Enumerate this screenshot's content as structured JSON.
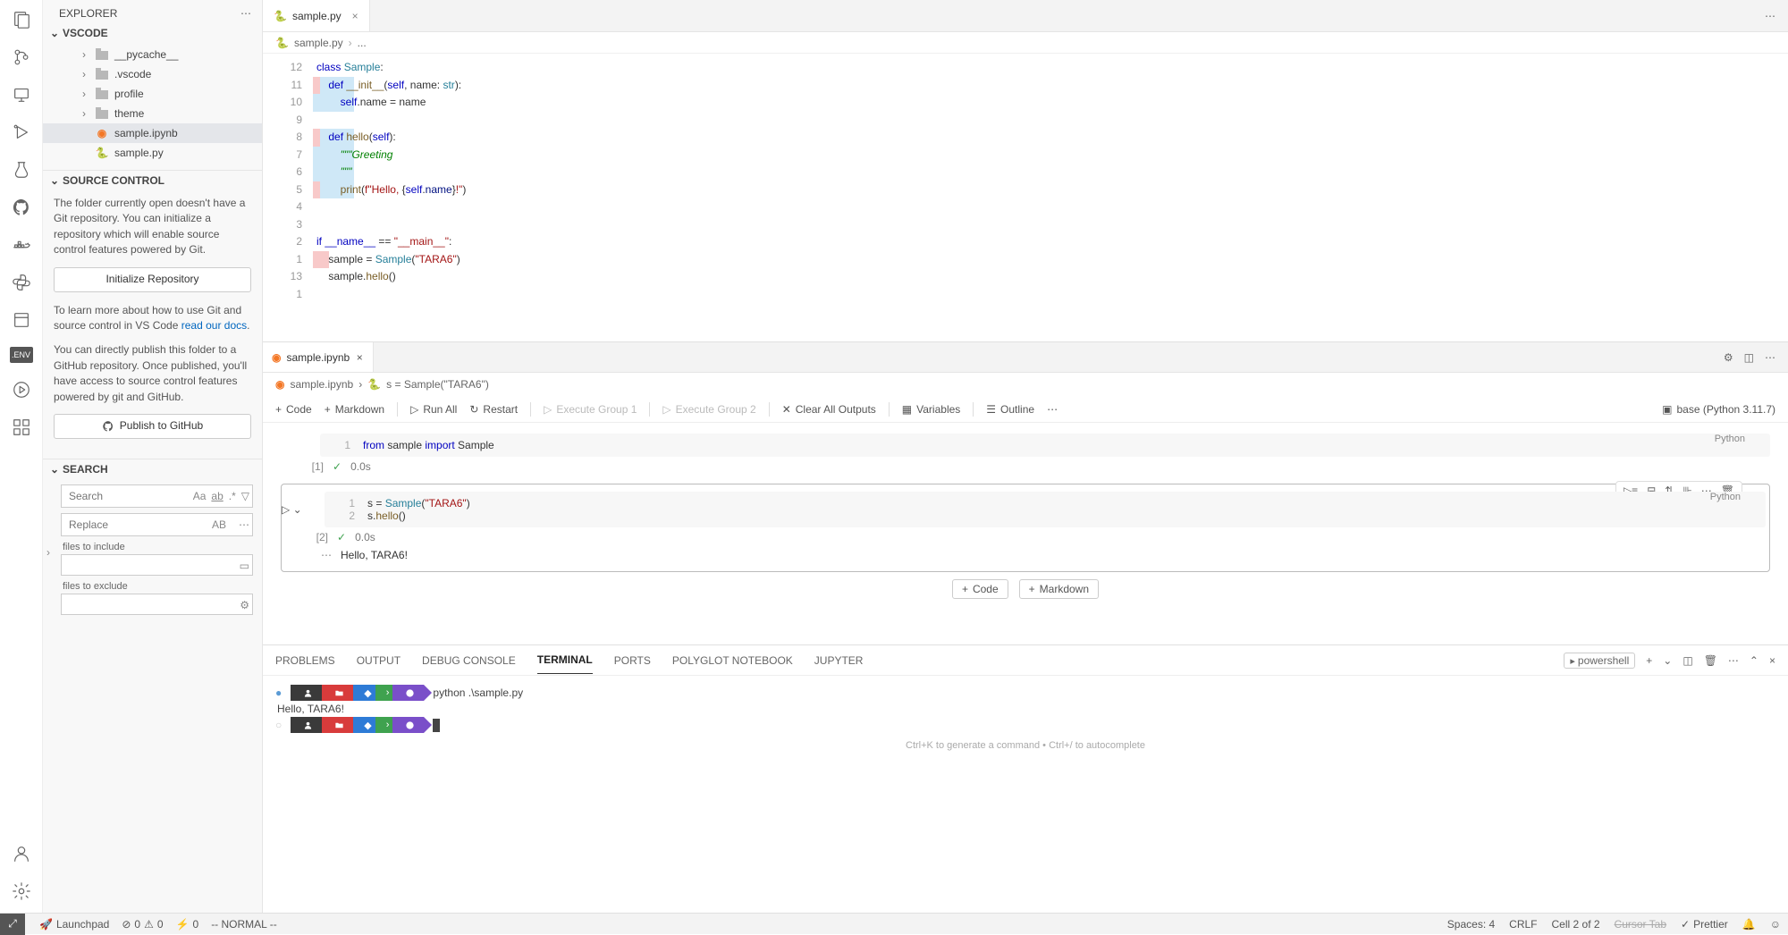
{
  "explorer": {
    "title": "EXPLORER",
    "root": "VSCODE",
    "tree": [
      {
        "label": "__pycache__",
        "type": "folder"
      },
      {
        "label": ".vscode",
        "type": "folder"
      },
      {
        "label": "profile",
        "type": "folder"
      },
      {
        "label": "theme",
        "type": "folder"
      },
      {
        "label": "sample.ipynb",
        "type": "ipynb",
        "selected": true
      },
      {
        "label": "sample.py",
        "type": "py"
      }
    ]
  },
  "source_control": {
    "title": "SOURCE CONTROL",
    "msg1": "The folder currently open doesn't have a Git repository. You can initialize a repository which will enable source control features powered by Git.",
    "init_btn": "Initialize Repository",
    "msg2_a": "To learn more about how to use Git and source control in VS Code ",
    "msg2_link": "read our docs",
    "msg3": "You can directly publish this folder to a GitHub repository. Once published, you'll have access to source control features powered by git and GitHub.",
    "publish_btn": "Publish to GitHub"
  },
  "search": {
    "title": "SEARCH",
    "search_ph": "Search",
    "replace_ph": "Replace",
    "include_label": "files to include",
    "exclude_label": "files to exclude"
  },
  "editor_tab": {
    "filename": "sample.py"
  },
  "breadcrumb": {
    "file": "sample.py",
    "scope": "..."
  },
  "code": {
    "linenos": [
      "12",
      "11",
      "10",
      "9",
      "8",
      "7",
      "6",
      "5",
      "4",
      "3",
      "2",
      "1",
      "13",
      "1"
    ],
    "lines": [
      {
        "html": "<span class='tok-kw'>class</span> <span class='tok-cls'>Sample</span>:",
        "d": "none"
      },
      {
        "html": "    <span class='tok-kw'>def</span> <span class='tok-fn'>__init__</span>(<span class='tok-self'>self</span>, name: <span class='tok-type'>str</span>):",
        "d": "both"
      },
      {
        "html": "        <span class='tok-self'>self</span>.name = name",
        "d": "add"
      },
      {
        "html": "",
        "d": "none"
      },
      {
        "html": "    <span class='tok-kw'>def</span> <span class='tok-fn'>hello</span>(<span class='tok-self'>self</span>):",
        "d": "both"
      },
      {
        "html": "        <span class='tok-doc'>\"\"\"Greeting</span>",
        "d": "add"
      },
      {
        "html": "        <span class='tok-doc'>\"\"\"</span>",
        "d": "add"
      },
      {
        "html": "        <span class='tok-fn'>print</span>(<span class='tok-str'>f\"Hello, </span>{<span class='tok-self'>self</span>.<span class='tok-attr'>name</span>}<span class='tok-str'>!\"</span>)",
        "d": "both"
      },
      {
        "html": "",
        "d": "none"
      },
      {
        "html": "",
        "d": "none"
      },
      {
        "html": "<span class='tok-kw'>if</span> <span class='tok-dunder'>__name__</span> == <span class='tok-str'>\"__main__\"</span>:",
        "d": "none"
      },
      {
        "html": "    sample = <span class='tok-call'>Sample</span>(<span class='tok-str'>\"TARA6\"</span>)",
        "d": "del2"
      },
      {
        "html": "    sample.<span class='tok-fn'>hello</span>()",
        "d": "none"
      },
      {
        "html": "",
        "d": "none"
      }
    ]
  },
  "notebook": {
    "tab": "sample.ipynb",
    "bc_file": "sample.ipynb",
    "bc_scope": "s = Sample(\"TARA6\")",
    "toolbar": {
      "code": "Code",
      "markdown": "Markdown",
      "run_all": "Run All",
      "restart": "Restart",
      "eg1": "Execute Group 1",
      "eg2": "Execute Group 2",
      "clear": "Clear All Outputs",
      "variables": "Variables",
      "outline": "Outline",
      "kernel": "base (Python 3.11.7)"
    },
    "cell1": {
      "idx": "[1]",
      "lines": [
        {
          "n": "1",
          "html": "<span class='tok-kw'>from</span> sample <span class='tok-kw'>import</span> Sample"
        }
      ],
      "time": "0.0s",
      "lang": "Python"
    },
    "cell2": {
      "idx": "[2]",
      "lines": [
        {
          "n": "1",
          "html": "s = <span class='tok-call'>Sample</span>(<span class='tok-str'>\"TARA6\"</span>)"
        },
        {
          "n": "2",
          "html": "s.<span class='tok-fn'>hello</span>()"
        }
      ],
      "time": "0.0s",
      "lang": "Python",
      "output": "Hello, TARA6!"
    },
    "add_code": "Code",
    "add_md": "Markdown"
  },
  "panel": {
    "tabs": [
      "PROBLEMS",
      "OUTPUT",
      "DEBUG CONSOLE",
      "TERMINAL",
      "PORTS",
      "POLYGLOT NOTEBOOK",
      "JUPYTER"
    ],
    "active": "TERMINAL",
    "shell": "powershell",
    "cmd": "python .\\sample.py",
    "out": "Hello, TARA6!",
    "hint": "Ctrl+K to generate a command • Ctrl+/ to autocomplete"
  },
  "status": {
    "launchpad": "Launchpad",
    "errors": "0",
    "warnings": "0",
    "ports": "0",
    "vim": "-- NORMAL --",
    "spaces": "Spaces: 4",
    "eol": "CRLF",
    "cell": "Cell 2 of 2",
    "cursortab": "Cursor Tab",
    "prettier": "Prettier"
  }
}
